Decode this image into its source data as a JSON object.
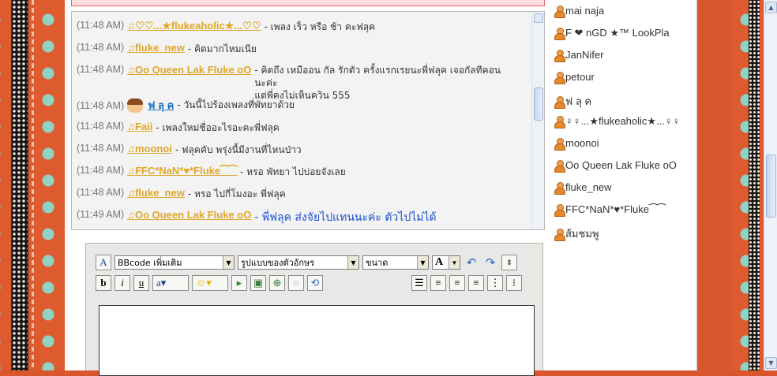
{
  "chat": {
    "messages": [
      {
        "time": "(11:48 AM)",
        "nick": "♫♡♡...★flukeaholic★...♡♡",
        "text": "- เพลง เร็ว หรือ ช้า คะฟลุค",
        "style": "normal"
      },
      {
        "time": "(11:48 AM)",
        "nick": "♫fluke_new",
        "text": "- คิดมากไหมเนีย",
        "style": "normal"
      },
      {
        "time": "(11:48 AM)",
        "nick": "♫Oo Queen Lak Fluke oO",
        "text": "- คิดถึง เหมืออน กัล รักตัว ครั้งแรกเรยนะพี่ฟลุค เจอกัลทีคอนนะค่ะ",
        "text2": "แต่พี่คงไม่เห็นควิน 555",
        "style": "normal"
      },
      {
        "time": "(11:48 AM)",
        "nick": "ฟ ลุ ค",
        "text": "- วันนี้ไปร้องเพลงที่พัทยาด้วย",
        "style": "blue-nick"
      },
      {
        "time": "(11:48 AM)",
        "nick": "♫Faii",
        "text": "- เพลงใหม่ชื่ออะไรอะคะพี่ฟลุค",
        "style": "normal"
      },
      {
        "time": "(11:48 AM)",
        "nick": "♫moonoi",
        "text": "- ฟลุคคับ พรุ่งนี้มีงานที่ไหนป่าว",
        "style": "normal"
      },
      {
        "time": "(11:48 AM)",
        "nick": "♫FFC*NaN*♥*Fluke⁀⁀",
        "text": "- หรอ พัทยา ไปบ่อยจังเลย",
        "style": "normal"
      },
      {
        "time": "(11:48 AM)",
        "nick": "♫fluke_new",
        "text": "- หรอ ไปกี่โมงอะ พี่ฟลุค",
        "style": "normal"
      },
      {
        "time": "(11:49 AM)",
        "nick": "♫Oo Queen Lak Fluke oO",
        "text": "- พี่ฟลุค ส่งจัยไปแทนนะค่ะ ตัวไปไม่ได้",
        "style": "blue-text"
      }
    ]
  },
  "users": [
    "mai naja",
    "F ❤ nGD ★™ LookPla",
    "JanNifer",
    "petour",
    "ฟ ลุ ค",
    "♀♀...★flukeaholic★...♀♀",
    "moonoi",
    "Oo Queen Lak Fluke oO",
    "fluke_new",
    "FFC*NaN*♥*Fluke⁀⁀",
    "ส้มชมพู"
  ],
  "editor": {
    "bbcode_select": "BBcode เพิ่มเติม",
    "font_select": "รูปแบบของตัวอักษร",
    "size_select": "ขนาด",
    "bold": "b",
    "italic": "i",
    "underline": "u",
    "color_glyph": "A"
  }
}
